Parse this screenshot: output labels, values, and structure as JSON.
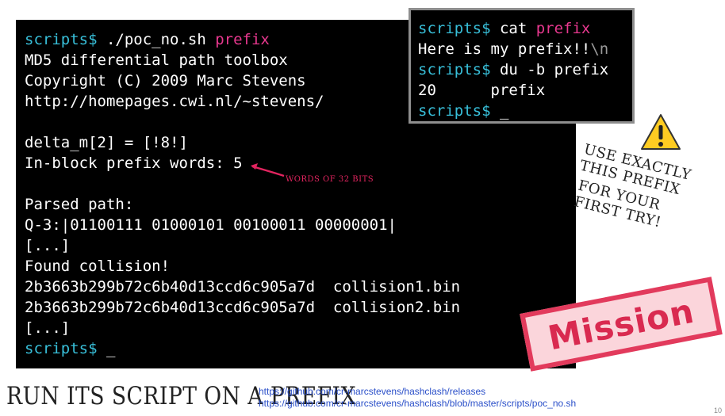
{
  "main_terminal": {
    "lines": [
      [
        {
          "t": "scripts$ ",
          "c": "cyan"
        },
        {
          "t": "./poc_no.sh ",
          "c": ""
        },
        {
          "t": "prefix",
          "c": "mag"
        }
      ],
      [
        {
          "t": "MD5 differential path toolbox",
          "c": ""
        }
      ],
      [
        {
          "t": "Copyright (C) 2009 Marc Stevens",
          "c": ""
        }
      ],
      [
        {
          "t": "http://homepages.cwi.nl/~stevens/",
          "c": ""
        }
      ],
      [],
      [
        {
          "t": "delta_m[2] = [!8!]",
          "c": ""
        }
      ],
      [
        {
          "t": "In-block prefix words: 5",
          "c": ""
        }
      ],
      [],
      [
        {
          "t": "Parsed path:",
          "c": ""
        }
      ],
      [
        {
          "t": "Q-3:|01100111 01000101 00100011 00000001|",
          "c": ""
        }
      ],
      [
        {
          "t": "[...]",
          "c": ""
        }
      ],
      [
        {
          "t": "Found collision!",
          "c": ""
        }
      ],
      [
        {
          "t": "2b3663b299b72c6b40d13ccd6c905a7d  collision1.bin",
          "c": ""
        }
      ],
      [
        {
          "t": "2b3663b299b72c6b40d13ccd6c905a7d  collision2.bin",
          "c": ""
        }
      ],
      [
        {
          "t": "[...]",
          "c": ""
        }
      ],
      [
        {
          "t": "scripts$ ",
          "c": "cyan"
        },
        {
          "t": "_",
          "c": ""
        }
      ]
    ]
  },
  "cat_terminal": {
    "lines": [
      [
        {
          "t": "scripts$ ",
          "c": "cyan"
        },
        {
          "t": "cat ",
          "c": ""
        },
        {
          "t": "prefix",
          "c": "mag"
        }
      ],
      [
        {
          "t": "Here is my prefix!!",
          "c": ""
        },
        {
          "t": "\\n",
          "c": "grey"
        }
      ],
      [
        {
          "t": "scripts$ ",
          "c": "cyan"
        },
        {
          "t": "du -b prefix",
          "c": ""
        }
      ],
      [
        {
          "t": "20      prefix",
          "c": ""
        }
      ],
      [
        {
          "t": "scripts$ ",
          "c": "cyan"
        },
        {
          "t": "_",
          "c": ""
        }
      ]
    ]
  },
  "annotations": {
    "words_note": "WORDS OF 32 BITS",
    "warning_line1": "USE EXACTLY THIS PREFIX",
    "warning_line2": "FOR YOUR FIRST TRY!",
    "warning_icon": "warning-icon"
  },
  "stamp": {
    "label": "Mission"
  },
  "footer": {
    "title": "RUN ITS SCRIPT ON A PREFIX",
    "links": [
      "https://github.com/cr-marcstevens/hashclash/releases",
      "https://github.com/cr-marcstevens/hashclash/blob/master/scripts/poc_no.sh"
    ],
    "page_number": "10"
  },
  "colors": {
    "prompt": "#38bfd9",
    "argument": "#e8388f",
    "annotation": "#e2245f",
    "stamp": "#d92a50",
    "link": "#2a4fc9"
  }
}
